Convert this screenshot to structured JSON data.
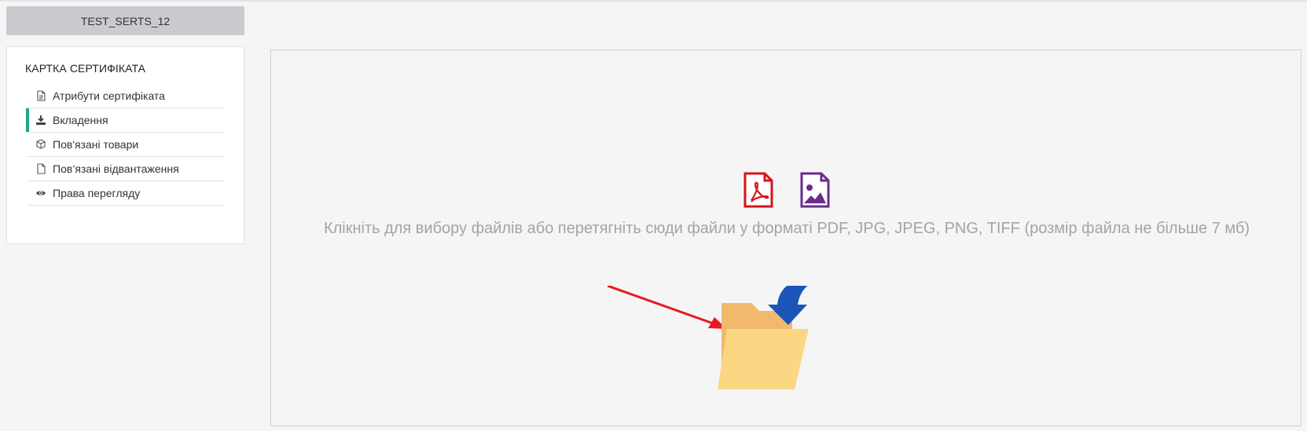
{
  "header": {
    "cert_tab_label": "TEST_SERTS_12"
  },
  "sidebar": {
    "title": "КАРТКА СЕРТИФІКАТА",
    "items": [
      {
        "label": "Атрибути сертифіката",
        "icon": "document-text-icon",
        "active": false
      },
      {
        "label": "Вкладення",
        "icon": "download-icon",
        "active": true
      },
      {
        "label": "Пов'язані товари",
        "icon": "box-icon",
        "active": false
      },
      {
        "label": "Пов’язані відвантаження",
        "icon": "file-icon",
        "active": false
      },
      {
        "label": "Права перегляду",
        "icon": "eye-icon",
        "active": false
      }
    ]
  },
  "dropzone": {
    "text": "Клікніть для вибору файлів або перетягніть сюди файли у форматі PDF, JPG, JPEG, PNG, TIFF (розмір файла не більше 7 мб)",
    "icons": [
      "pdf-file-icon",
      "image-file-icon",
      "folder-icon"
    ]
  },
  "colors": {
    "accent": "#1fa589",
    "pdf_icon": "#d9141b",
    "image_icon": "#6a2b8a",
    "folder_back": "#f0b96b",
    "folder_front": "#fbd783",
    "arrow_blue": "#1b55b8",
    "annotation_arrow": "#e8191f"
  }
}
